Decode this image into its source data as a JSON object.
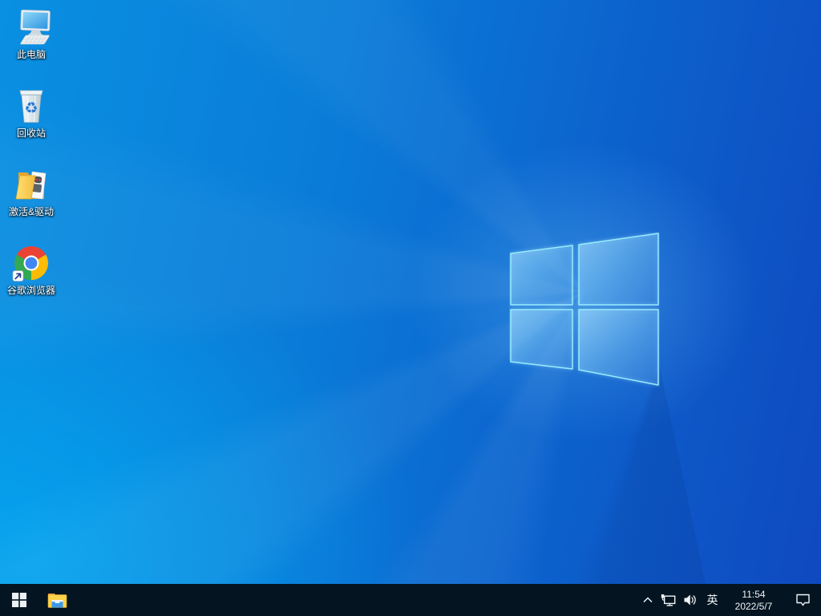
{
  "wallpaper": {
    "style": "windows10-default-light-rays",
    "base_color_left": "#0990e2",
    "base_color_right": "#0f49c0",
    "bloom_color": "#00beff",
    "logo_edge_color": "#9beeff",
    "logo_pane_color": "#3aa2ea"
  },
  "desktop": {
    "icons": [
      {
        "label": "此电脑",
        "icon": "this-pc-icon"
      },
      {
        "label": "回收站",
        "icon": "recycle-bin-icon"
      },
      {
        "label": "激活&驱动",
        "icon": "activation-driver-folder-icon"
      },
      {
        "label": "谷歌浏览器",
        "icon": "chrome-icon"
      }
    ]
  },
  "taskbar": {
    "background_color": "#041420",
    "start": {
      "icon": "windows-start-icon"
    },
    "pinned": [
      {
        "icon": "file-explorer-icon"
      }
    ],
    "tray": {
      "hidden_icons": {
        "icon": "chevron-up-icon"
      },
      "network": {
        "icon": "network-ethernet-icon"
      },
      "volume": {
        "icon": "speaker-icon"
      },
      "ime_label": "英",
      "clock": {
        "time": "11:54",
        "date": "2022/5/7"
      },
      "action_center": {
        "icon": "action-center-icon"
      }
    }
  }
}
